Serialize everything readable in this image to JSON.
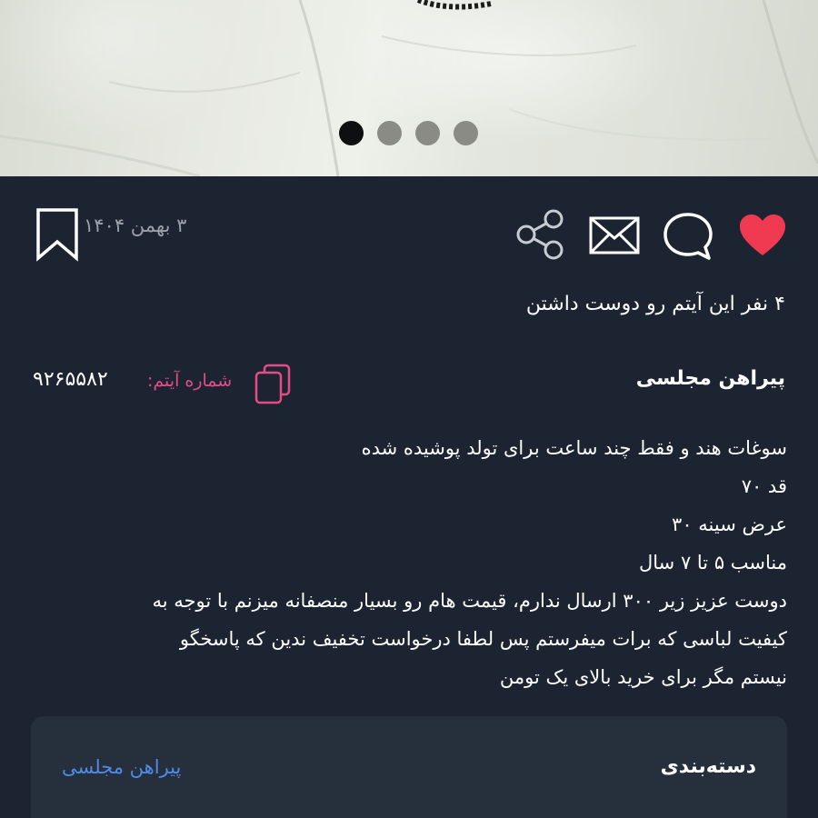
{
  "carousel": {
    "slide_count": 4,
    "active_index": 0,
    "colors": {
      "active": "#0d0f10",
      "inactive": "#8a8b84"
    }
  },
  "actions": {
    "date": "۳ بهمن ۱۴۰۴",
    "icons": [
      "bookmark-icon",
      "share-icon",
      "mail-icon",
      "comment-icon",
      "heart-icon"
    ],
    "liked": true,
    "heart_color": "#f03a52"
  },
  "likes_text": "۴ نفر این آیتم رو دوست داشتن",
  "item": {
    "title": "پیراهن مجلسی",
    "number_label": "شماره آیتم:",
    "number": "۹۲۶۵۵۸۲",
    "accent_color": "#e64b87"
  },
  "description": {
    "lines": [
      "سوغات هند و فقط چند ساعت برای تولد پوشیده شده",
      "قد ۷۰",
      "عرض سینه ۳۰",
      "مناسب ۵ تا ۷ سال",
      "دوست عزیز زیر ۳۰۰ ارسال ندارم، قیمت هام رو بسیار منصفانه میزنم با توجه به",
      "کیفیت لباسی که برات میفرستم پس لطفا درخواست تخفیف ندین که پاسخگو",
      "نیستم مگر برای خرید بالای یک تومن"
    ]
  },
  "category": {
    "label": "دسته‌بندی",
    "value": "پیراهن مجلسی",
    "link_color": "#4e8ae6"
  }
}
